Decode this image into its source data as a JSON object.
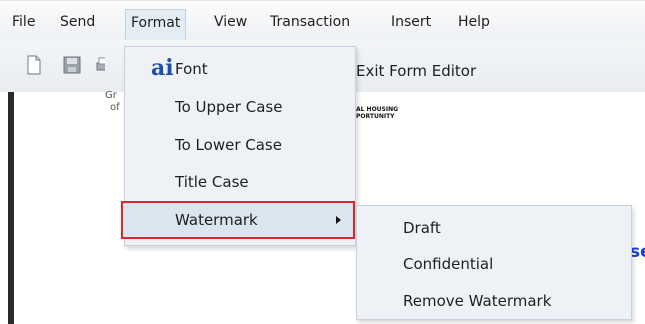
{
  "menubar": {
    "items": [
      {
        "label": "File"
      },
      {
        "label": "Send"
      },
      {
        "label": "Format"
      },
      {
        "label": "View"
      },
      {
        "label": "Transaction"
      },
      {
        "label": "Insert"
      },
      {
        "label": "Help"
      }
    ]
  },
  "toolbar": {
    "exit_label": "Exit Form Editor"
  },
  "format_menu": {
    "font_glyph": "ai",
    "items": [
      {
        "label": "Font"
      },
      {
        "label": "To Upper Case"
      },
      {
        "label": "To Lower Case"
      },
      {
        "label": "Title Case"
      },
      {
        "label": "Watermark"
      }
    ]
  },
  "watermark_submenu": {
    "items": [
      {
        "label": "Draft"
      },
      {
        "label": "Confidential"
      },
      {
        "label": "Remove Watermark"
      }
    ]
  },
  "document": {
    "frag_left_1": "Gr",
    "frag_left_2": "of",
    "frag_logo_1": "AL HOUSING",
    "frag_logo_2": "PORTUNITY",
    "frag_right": "se"
  },
  "colors": {
    "highlight_border": "#e0242a",
    "link_blue": "#1a3fd8"
  }
}
